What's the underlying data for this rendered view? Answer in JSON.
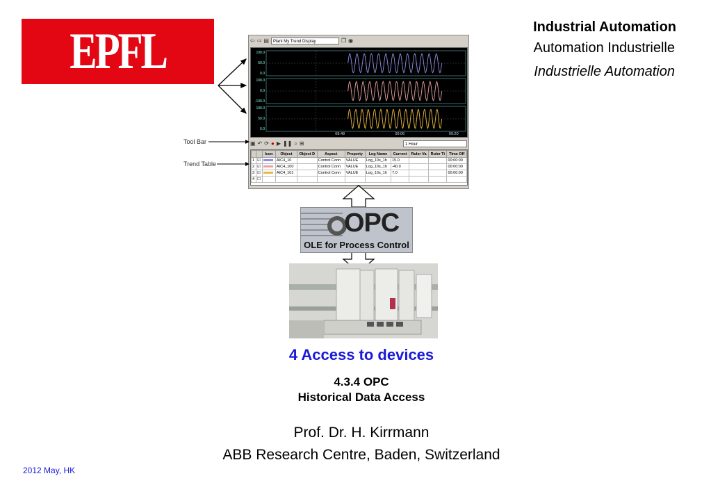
{
  "logo": {
    "text": "EPFL",
    "color": "#e30613"
  },
  "titles": {
    "line1": "Industrial Automation",
    "line2": "Automation Industrielle",
    "line3": "Industrielle Automation"
  },
  "trend_window": {
    "display_name": "Plant My Trend Display",
    "time_range": "1 Hour",
    "time_ticks": [
      "08:48",
      "09:06",
      "09:20"
    ],
    "y_ticks": {
      "panel1": [
        "100.0",
        "50.0",
        "0.0"
      ],
      "panel2": [
        "100.0",
        "0.0",
        "-100.0"
      ],
      "panel3": [
        "100.0",
        "50.0",
        "0.0"
      ]
    },
    "table": {
      "headers": [
        "",
        "",
        "Icon",
        "Object",
        "Object D",
        "Aspect",
        "Property",
        "Log Name",
        "Current",
        "Ruler Va",
        "Ruler Ti",
        "Time Off"
      ],
      "rows": [
        [
          "1",
          "☑",
          "",
          "AIC4_10",
          "",
          "Control Conn",
          "VALUE",
          "Log_10s_1h",
          "15.0",
          "",
          "",
          "00:00:00"
        ],
        [
          "2",
          "☑",
          "",
          "AIC4_100",
          "",
          "Control Conn",
          "VALUE",
          "Log_10s_1h",
          "-40.0",
          "",
          "",
          "00:00:00"
        ],
        [
          "3",
          "☑",
          "",
          "AIC4_101",
          "",
          "Control Conn",
          "VALUE",
          "Log_10s_1h",
          "7.0",
          "",
          "",
          "00:00:00"
        ],
        [
          "4",
          "☐",
          "",
          "",
          "",
          "",
          "",
          "",
          "",
          "",
          "",
          ""
        ]
      ]
    },
    "series_colors": [
      "#8f8fe8",
      "#e8a0a0",
      "#e8b840"
    ]
  },
  "annotations": {
    "toolbar": "Tool Bar",
    "trend_table": "Trend Table"
  },
  "opc": {
    "word": "OPC",
    "subtitle": "OLE for Process Control"
  },
  "section": {
    "title": "4 Access to devices",
    "subtitle1": "4.3.4 OPC",
    "subtitle2": "Historical Data Access"
  },
  "author": "Prof. Dr. H. Kirrmann",
  "affiliation": "ABB Research Centre, Baden, Switzerland",
  "date": "2012 May, HK"
}
